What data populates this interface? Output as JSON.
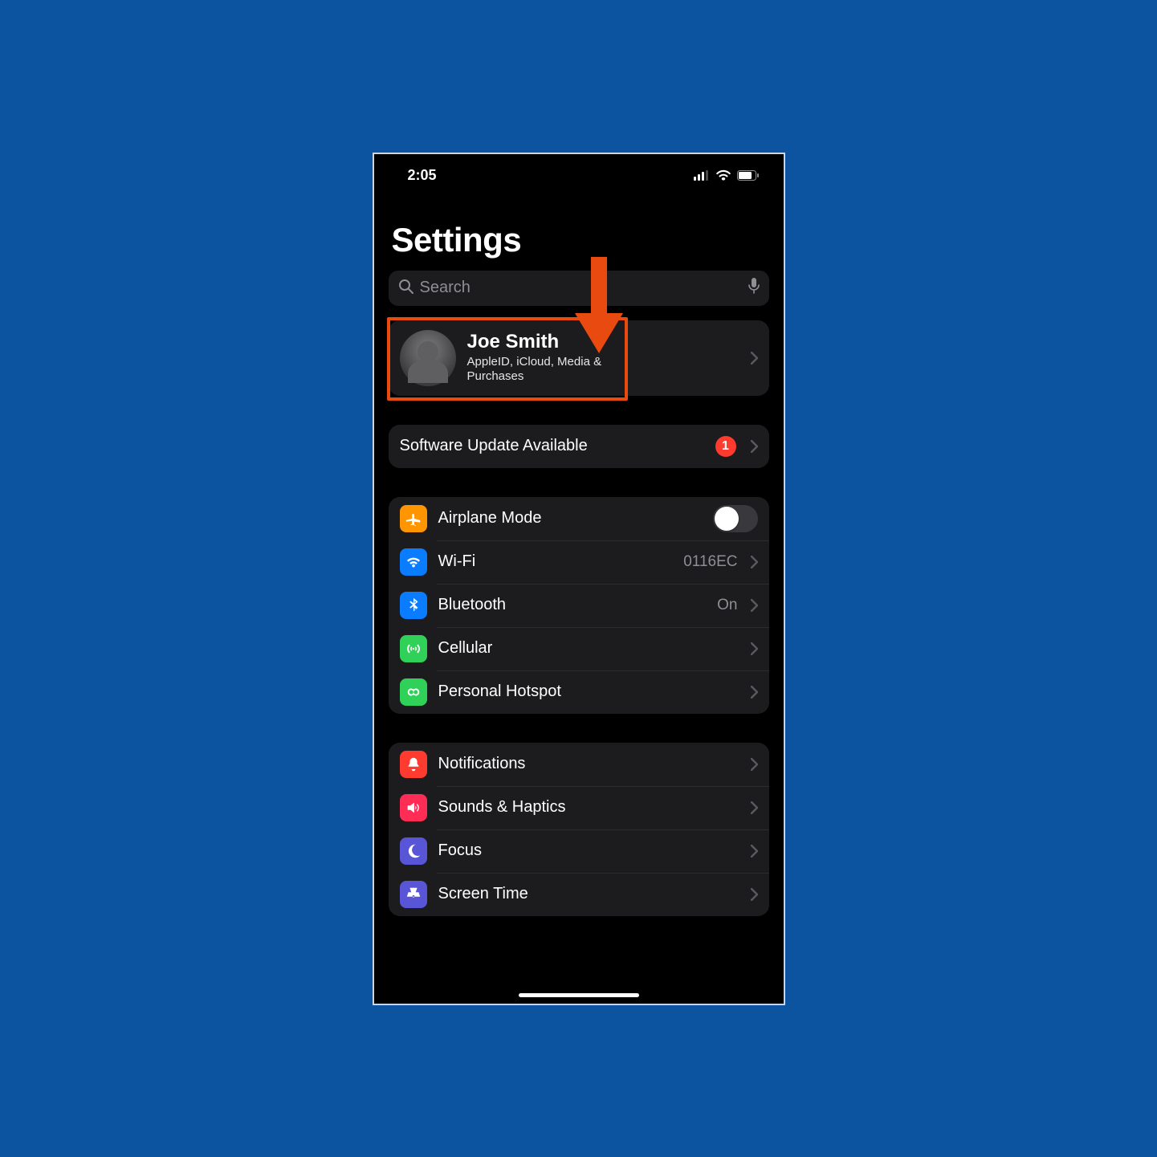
{
  "status": {
    "time": "2:05"
  },
  "page": {
    "title": "Settings"
  },
  "search": {
    "placeholder": "Search"
  },
  "account": {
    "name": "Joe Smith",
    "subtitle": "AppleID, iCloud, Media & Purchases"
  },
  "update": {
    "label": "Software Update Available",
    "badge": "1"
  },
  "network": {
    "airplane": {
      "label": "Airplane Mode",
      "on": false,
      "color": "#ff9500"
    },
    "wifi": {
      "label": "Wi-Fi",
      "value": "0116EC",
      "color": "#0a7cff"
    },
    "bluetooth": {
      "label": "Bluetooth",
      "value": "On",
      "color": "#0a7cff"
    },
    "cellular": {
      "label": "Cellular",
      "color": "#30d158"
    },
    "hotspot": {
      "label": "Personal Hotspot",
      "color": "#30d158"
    }
  },
  "general": {
    "notifications": {
      "label": "Notifications",
      "color": "#ff3b30"
    },
    "sounds": {
      "label": "Sounds & Haptics",
      "color": "#ff2d55"
    },
    "focus": {
      "label": "Focus",
      "color": "#5856d6"
    },
    "screentime": {
      "label": "Screen Time",
      "color": "#5856d6"
    }
  },
  "annotation": {
    "arrow_color": "#e84a0f",
    "highlight_color": "#e84a0f"
  }
}
